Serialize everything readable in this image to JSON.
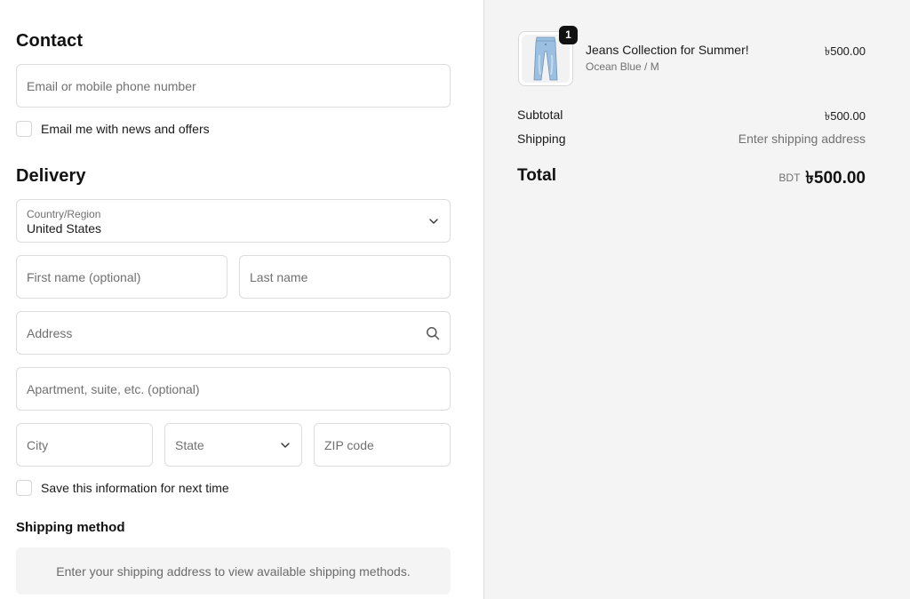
{
  "contact": {
    "heading": "Contact",
    "email_placeholder": "Email or mobile phone number",
    "news_label": "Email me with news and offers"
  },
  "delivery": {
    "heading": "Delivery",
    "country_label": "Country/Region",
    "country_value": "United States",
    "first_name_placeholder": "First name (optional)",
    "last_name_placeholder": "Last name",
    "address_placeholder": "Address",
    "apartment_placeholder": "Apartment, suite, etc. (optional)",
    "city_placeholder": "City",
    "state_placeholder": "State",
    "zip_placeholder": "ZIP code",
    "save_label": "Save this information for next time"
  },
  "shipping_method": {
    "heading": "Shipping method",
    "notice": "Enter your shipping address to view available shipping methods."
  },
  "summary": {
    "product_name": "Jeans Collection for Summer!",
    "product_variant": "Ocean Blue / M",
    "product_price": "৳500.00",
    "quantity_badge": "1",
    "subtotal_label": "Subtotal",
    "subtotal_value": "৳500.00",
    "shipping_label": "Shipping",
    "shipping_value": "Enter shipping address",
    "total_label": "Total",
    "total_currency": "BDT",
    "total_value": "৳500.00"
  },
  "icons": {
    "country_chevron": "chevron-down-icon",
    "state_chevron": "chevron-down-icon",
    "address_search": "search-icon"
  },
  "colors": {
    "summary_background": "#f4f4f4",
    "border": "#dcdcdc",
    "badge": "#111111"
  }
}
